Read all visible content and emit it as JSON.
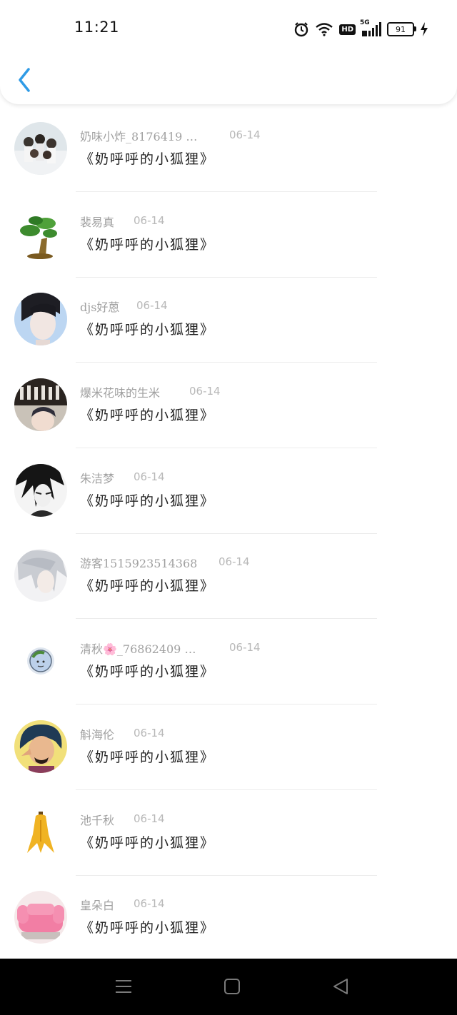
{
  "status_bar": {
    "time": "11:21",
    "network_label": "5G",
    "hd_label": "HD",
    "battery": "91"
  },
  "icons": {
    "back": "chevron-left-icon",
    "alarm": "alarm-icon",
    "wifi": "wifi-icon",
    "signal": "signal-icon",
    "charging": "lightning-icon",
    "nav_menu": "menu-icon",
    "nav_home": "home-square-icon",
    "nav_back": "back-triangle-icon"
  },
  "colors": {
    "accent": "#2f9be6",
    "name_text": "#a0a0a0",
    "title_text": "#222222"
  },
  "items": [
    {
      "name": "奶味小炸_8176419 …",
      "date": "06-14",
      "title": "《奶呼呼的小狐狸》"
    },
    {
      "name": "裴易真",
      "date": "06-14",
      "title": "《奶呼呼的小狐狸》"
    },
    {
      "name": "djs好蒽",
      "date": "06-14",
      "title": "《奶呼呼的小狐狸》"
    },
    {
      "name": "爆米花味的生米",
      "date": "06-14",
      "title": "《奶呼呼的小狐狸》"
    },
    {
      "name": "朱洁梦",
      "date": "06-14",
      "title": "《奶呼呼的小狐狸》"
    },
    {
      "name": "游客1515923514368",
      "date": "06-14",
      "title": "《奶呼呼的小狐狸》"
    },
    {
      "name": "清秋🌸_76862409 …",
      "date": "06-14",
      "title": "《奶呼呼的小狐狸》"
    },
    {
      "name": "斛海伦",
      "date": "06-14",
      "title": "《奶呼呼的小狐狸》"
    },
    {
      "name": "池千秋",
      "date": "06-14",
      "title": "《奶呼呼的小狐狸》"
    },
    {
      "name": "皇朵白",
      "date": "06-14",
      "title": "《奶呼呼的小狐狸》"
    }
  ]
}
